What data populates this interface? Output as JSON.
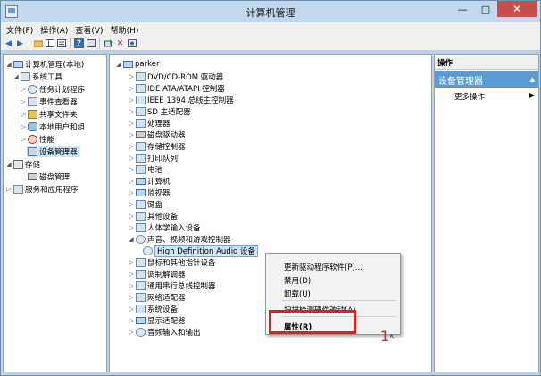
{
  "window": {
    "title": "计算机管理"
  },
  "window_buttons": {
    "minimize": "—",
    "maximize": "□",
    "close": "✕"
  },
  "menu": [
    "文件(F)",
    "操作(A)",
    "查看(V)",
    "帮助(H)"
  ],
  "toolbar_icons": [
    "back-arrow-icon",
    "forward-arrow-icon",
    "up-folder-icon",
    "show-hide-tree-icon",
    "properties-icon",
    "help-icon",
    "console-icon",
    "update-driver-icon",
    "uninstall-icon",
    "scan-hardware-icon"
  ],
  "left_tree": {
    "root": "计算机管理(本地)",
    "groups": [
      {
        "label": "系统工具",
        "children": [
          "任务计划程序",
          "事件查看器",
          "共享文件夹",
          "本地用户和组",
          "性能",
          "设备管理器"
        ]
      },
      {
        "label": "存储",
        "children": [
          "磁盘管理"
        ]
      },
      {
        "label": "服务和应用程序",
        "children": []
      }
    ]
  },
  "device_tree": {
    "root": "parker",
    "categories_before": [
      "DVD/CD-ROM 驱动器",
      "IDE ATA/ATAPI 控制器",
      "IEEE 1394 总线主控制器",
      "SD 主适配器",
      "处理器",
      "磁盘驱动器",
      "存储控制器",
      "打印队列",
      "电池",
      "计算机",
      "监视器",
      "键盘",
      "其他设备",
      "人体学输入设备"
    ],
    "expanded_category": "声音、视频和游戏控制器",
    "expanded_device": "High Definition Audio 设备",
    "categories_after": [
      "鼠标和其他指针设备",
      "调制解调器",
      "通用串行总线控制器",
      "网络适配器",
      "系统设备",
      "显示适配器",
      "音频输入和输出"
    ]
  },
  "actions": {
    "header": "操作",
    "section": "设备管理器",
    "more": "更多操作"
  },
  "context_menu": {
    "update": "更新驱动程序软件(P)...",
    "disable": "禁用(D)",
    "uninstall": "卸载(U)",
    "scan": "扫描检测硬件改动(A)",
    "properties": "属性(R)"
  },
  "annotation": {
    "step": "1"
  }
}
